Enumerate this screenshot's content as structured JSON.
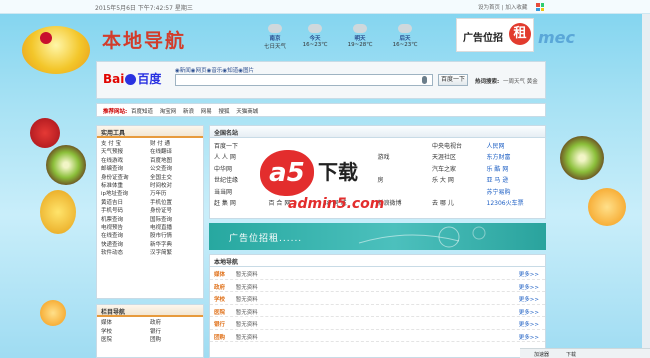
{
  "topbar": {
    "datetime": "2015年5月6日 下午7:42:57 星期三",
    "links": "设为首页 | 加入收藏"
  },
  "header": {
    "logo": "本地导航",
    "weather": [
      {
        "city": "南京",
        "desc": "七日天气"
      },
      {
        "city": "今天",
        "desc": "16~23℃"
      },
      {
        "city": "明天",
        "desc": "19~28℃"
      },
      {
        "city": "后天",
        "desc": "16~23℃"
      }
    ],
    "ad": {
      "text": "广告位招",
      "badge": "租"
    },
    "deco_text": "mec"
  },
  "search": {
    "brand_left": "Bai",
    "brand_right": "百度",
    "radio_options": "◉新闻◉网页◉音乐◉知道◉图片",
    "input_value": "",
    "button_label": "百度一下",
    "hot_label": "热词搜索:",
    "hot_items": "一周天气  黄金"
  },
  "recommend": {
    "label": "推荐网站:",
    "items": [
      "百度知道",
      "淘宝网",
      "新浪",
      "网易",
      "搜狐",
      "天猫商城"
    ]
  },
  "tools": {
    "title": "实用工具",
    "items": [
      "支 付 宝",
      "财 付 通",
      "天气预报",
      "在线翻译",
      "在线游戏",
      "百度地图",
      "邮编查询",
      "公交查询",
      "身份证查询",
      "全国主交",
      "标准体重",
      "时间校对",
      "ip地址查询",
      "万年历",
      "黄道吉日",
      "手机位置",
      "手机号码",
      "身份证号",
      "机票查询",
      "国际查询",
      "电视预告",
      "电视直播",
      "在线查询",
      "股市行情",
      "快递查询",
      "新华字典",
      "软件动态",
      "汉字简繁"
    ]
  },
  "nav2": {
    "title": "栏目导航",
    "items": [
      "媒体",
      "政府",
      "学校",
      "银行",
      "医院",
      "团购"
    ]
  },
  "famous": {
    "title": "全国名站",
    "items": [
      "百度一下",
      "",
      "",
      "",
      "中央电视台",
      "人民网",
      "人 人 网",
      "",
      "",
      "游戏",
      "天涯社区",
      "东方财富",
      "中华网",
      "",
      "",
      "",
      "汽车之家",
      "乐 酷 网",
      "世纪佳缘",
      "",
      "",
      "房",
      "乐 大 网",
      "亚 马 逊",
      "当当网",
      "",
      "",
      "",
      "",
      "苏宁易购",
      "赶 集 网",
      "百 合 网",
      "58 同 城",
      "新浪微博",
      "去 哪 儿",
      "12306火车票"
    ],
    "blue_index": [
      5,
      11,
      17,
      23,
      29,
      35
    ]
  },
  "watermark": {
    "logo": "a5",
    "title": "下载",
    "url": "admin5.com"
  },
  "adbanner": {
    "text": "广告位招租......"
  },
  "localnav": {
    "title": "本地导航",
    "rows": [
      {
        "cat": "媒体",
        "text": "暂无资料",
        "more": "更多>>"
      },
      {
        "cat": "政府",
        "text": "暂无资料",
        "more": "更多>>"
      },
      {
        "cat": "学校",
        "text": "暂无资料",
        "more": "更多>>"
      },
      {
        "cat": "医院",
        "text": "暂无资料",
        "more": "更多>>"
      },
      {
        "cat": "银行",
        "text": "暂无资料",
        "more": "更多>>"
      },
      {
        "cat": "团购",
        "text": "暂无资料",
        "more": "更多>>"
      }
    ]
  },
  "statusbar": {
    "left": "加速器",
    "right": "下载"
  }
}
